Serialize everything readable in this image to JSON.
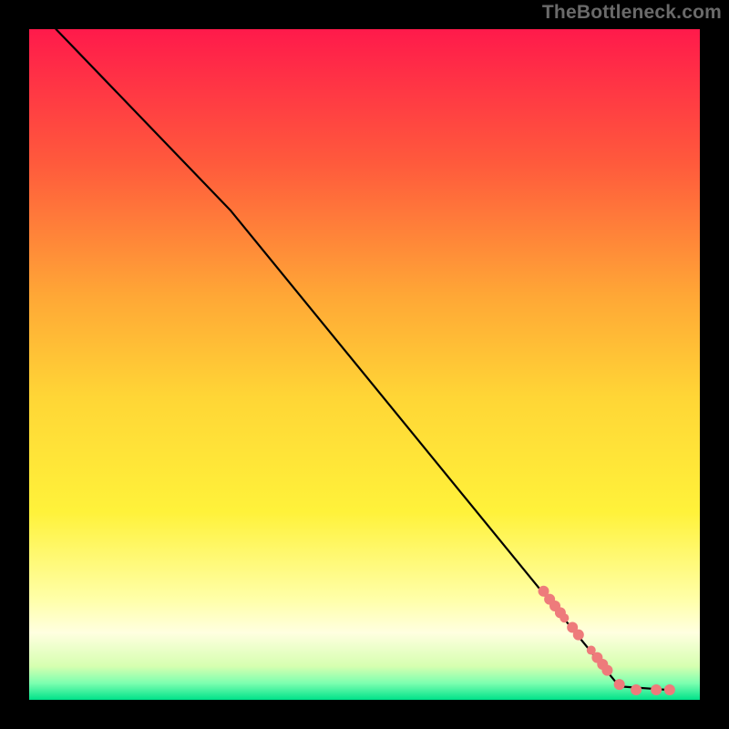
{
  "watermark": "TheBottleneck.com",
  "chart_data": {
    "type": "line",
    "title": "",
    "xlabel": "",
    "ylabel": "",
    "xlim": [
      0,
      100
    ],
    "ylim": [
      0,
      100
    ],
    "gradient_stops": [
      {
        "pos": 0.0,
        "color": "#ff1a4b"
      },
      {
        "pos": 0.2,
        "color": "#ff5a3c"
      },
      {
        "pos": 0.4,
        "color": "#ffa836"
      },
      {
        "pos": 0.55,
        "color": "#ffd636"
      },
      {
        "pos": 0.72,
        "color": "#fff23a"
      },
      {
        "pos": 0.85,
        "color": "#ffffa8"
      },
      {
        "pos": 0.9,
        "color": "#ffffe0"
      },
      {
        "pos": 0.95,
        "color": "#d6ffb0"
      },
      {
        "pos": 0.975,
        "color": "#7dffb0"
      },
      {
        "pos": 1.0,
        "color": "#00e28a"
      }
    ],
    "series": [
      {
        "name": "trend-line",
        "color": "#000000",
        "points": [
          {
            "x": 4,
            "y": 100
          },
          {
            "x": 30,
            "y": 73
          },
          {
            "x": 88,
            "y": 2
          },
          {
            "x": 95,
            "y": 1.5
          }
        ]
      }
    ],
    "markers": {
      "color": "#ee7b7b",
      "points": [
        {
          "x": 76.7,
          "y": 16.2,
          "r": 6
        },
        {
          "x": 77.6,
          "y": 15.0,
          "r": 6
        },
        {
          "x": 78.4,
          "y": 14.0,
          "r": 6
        },
        {
          "x": 79.2,
          "y": 13.0,
          "r": 6
        },
        {
          "x": 79.8,
          "y": 12.2,
          "r": 5
        },
        {
          "x": 81.0,
          "y": 10.8,
          "r": 6
        },
        {
          "x": 81.9,
          "y": 9.7,
          "r": 6
        },
        {
          "x": 83.8,
          "y": 7.4,
          "r": 5
        },
        {
          "x": 84.7,
          "y": 6.3,
          "r": 6
        },
        {
          "x": 85.5,
          "y": 5.3,
          "r": 6
        },
        {
          "x": 86.2,
          "y": 4.4,
          "r": 6
        },
        {
          "x": 88.0,
          "y": 2.3,
          "r": 6
        },
        {
          "x": 90.5,
          "y": 1.5,
          "r": 6
        },
        {
          "x": 93.5,
          "y": 1.5,
          "r": 6
        },
        {
          "x": 95.5,
          "y": 1.5,
          "r": 6
        }
      ]
    }
  }
}
